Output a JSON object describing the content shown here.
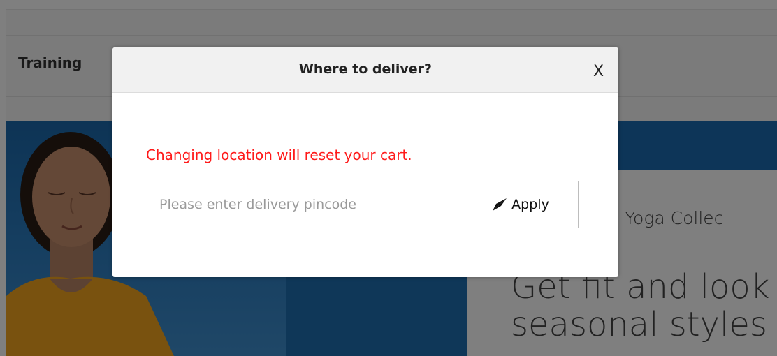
{
  "nav": {
    "item_training": "Training"
  },
  "promo": {
    "subtitle": "na Yoga Collec",
    "headline_line1": "Get fit and look",
    "headline_line2": "seasonal styles"
  },
  "modal": {
    "title": "Where to deliver?",
    "close_label": "X",
    "warning": "Changing location will reset your cart.",
    "pincode_placeholder": "Please enter delivery pincode",
    "pincode_value": "",
    "apply_label": "Apply",
    "apply_icon": "send-arrow-icon"
  },
  "colors": {
    "warning": "#ff1a1a",
    "overlay": "rgba(0,0,0,0.5)",
    "hero_blue": "#1f6fb0"
  }
}
